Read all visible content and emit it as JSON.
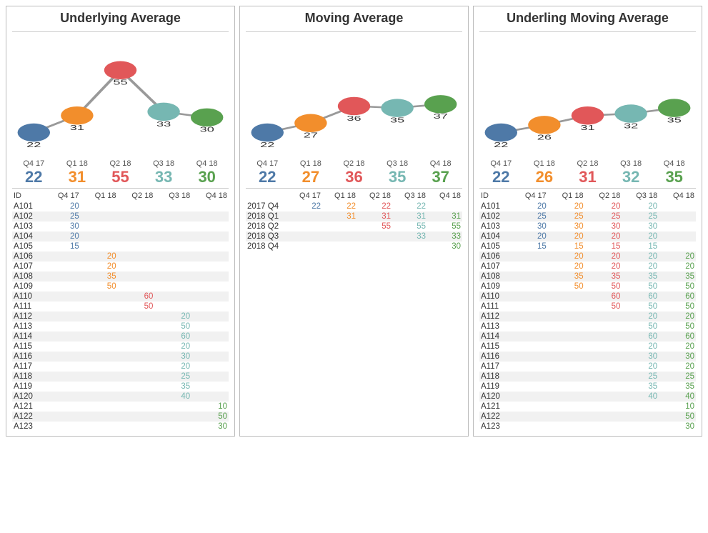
{
  "colors": [
    "#4e79a7",
    "#f28e2c",
    "#e15759",
    "#76b7b2",
    "#59a14f"
  ],
  "quarters": [
    "Q4 17",
    "Q1 18",
    "Q2 18",
    "Q3 18",
    "Q4 18"
  ],
  "panels": [
    {
      "title": "Underlying Average",
      "summary": [
        22,
        31,
        55,
        33,
        30
      ],
      "id_label": "ID",
      "rows": [
        {
          "id": "A101",
          "cells": [
            20,
            null,
            null,
            null,
            null
          ]
        },
        {
          "id": "A102",
          "cells": [
            25,
            null,
            null,
            null,
            null
          ]
        },
        {
          "id": "A103",
          "cells": [
            30,
            null,
            null,
            null,
            null
          ]
        },
        {
          "id": "A104",
          "cells": [
            20,
            null,
            null,
            null,
            null
          ]
        },
        {
          "id": "A105",
          "cells": [
            15,
            null,
            null,
            null,
            null
          ]
        },
        {
          "id": "A106",
          "cells": [
            null,
            20,
            null,
            null,
            null
          ]
        },
        {
          "id": "A107",
          "cells": [
            null,
            20,
            null,
            null,
            null
          ]
        },
        {
          "id": "A108",
          "cells": [
            null,
            35,
            null,
            null,
            null
          ]
        },
        {
          "id": "A109",
          "cells": [
            null,
            50,
            null,
            null,
            null
          ]
        },
        {
          "id": "A110",
          "cells": [
            null,
            null,
            60,
            null,
            null
          ]
        },
        {
          "id": "A111",
          "cells": [
            null,
            null,
            50,
            null,
            null
          ]
        },
        {
          "id": "A112",
          "cells": [
            null,
            null,
            null,
            20,
            null
          ]
        },
        {
          "id": "A113",
          "cells": [
            null,
            null,
            null,
            50,
            null
          ]
        },
        {
          "id": "A114",
          "cells": [
            null,
            null,
            null,
            60,
            null
          ]
        },
        {
          "id": "A115",
          "cells": [
            null,
            null,
            null,
            20,
            null
          ]
        },
        {
          "id": "A116",
          "cells": [
            null,
            null,
            null,
            30,
            null
          ]
        },
        {
          "id": "A117",
          "cells": [
            null,
            null,
            null,
            20,
            null
          ]
        },
        {
          "id": "A118",
          "cells": [
            null,
            null,
            null,
            25,
            null
          ]
        },
        {
          "id": "A119",
          "cells": [
            null,
            null,
            null,
            35,
            null
          ]
        },
        {
          "id": "A120",
          "cells": [
            null,
            null,
            null,
            40,
            null
          ]
        },
        {
          "id": "A121",
          "cells": [
            null,
            null,
            null,
            null,
            10
          ]
        },
        {
          "id": "A122",
          "cells": [
            null,
            null,
            null,
            null,
            50
          ]
        },
        {
          "id": "A123",
          "cells": [
            null,
            null,
            null,
            null,
            30
          ]
        }
      ]
    },
    {
      "title": "Moving Average",
      "summary": [
        22,
        27,
        36,
        35,
        37
      ],
      "id_label": "",
      "row_label_style": "period",
      "rows": [
        {
          "id": "2017 Q4",
          "cells": [
            22,
            22,
            22,
            22,
            null
          ]
        },
        {
          "id": "2018 Q1",
          "cells": [
            null,
            31,
            31,
            31,
            31
          ]
        },
        {
          "id": "2018 Q2",
          "cells": [
            null,
            null,
            55,
            55,
            55
          ]
        },
        {
          "id": "2018 Q3",
          "cells": [
            null,
            null,
            null,
            33,
            33
          ]
        },
        {
          "id": "2018 Q4",
          "cells": [
            null,
            null,
            null,
            null,
            30
          ]
        }
      ]
    },
    {
      "title": "Underling Moving Average",
      "summary": [
        22,
        26,
        31,
        32,
        35
      ],
      "id_label": "ID",
      "rows": [
        {
          "id": "A101",
          "cells": [
            20,
            20,
            20,
            20,
            null
          ]
        },
        {
          "id": "A102",
          "cells": [
            25,
            25,
            25,
            25,
            null
          ]
        },
        {
          "id": "A103",
          "cells": [
            30,
            30,
            30,
            30,
            null
          ]
        },
        {
          "id": "A104",
          "cells": [
            20,
            20,
            20,
            20,
            null
          ]
        },
        {
          "id": "A105",
          "cells": [
            15,
            15,
            15,
            15,
            null
          ]
        },
        {
          "id": "A106",
          "cells": [
            null,
            20,
            20,
            20,
            20
          ]
        },
        {
          "id": "A107",
          "cells": [
            null,
            20,
            20,
            20,
            20
          ]
        },
        {
          "id": "A108",
          "cells": [
            null,
            35,
            35,
            35,
            35
          ]
        },
        {
          "id": "A109",
          "cells": [
            null,
            50,
            50,
            50,
            50
          ]
        },
        {
          "id": "A110",
          "cells": [
            null,
            null,
            60,
            60,
            60
          ]
        },
        {
          "id": "A111",
          "cells": [
            null,
            null,
            50,
            50,
            50
          ]
        },
        {
          "id": "A112",
          "cells": [
            null,
            null,
            null,
            20,
            20
          ]
        },
        {
          "id": "A113",
          "cells": [
            null,
            null,
            null,
            50,
            50
          ]
        },
        {
          "id": "A114",
          "cells": [
            null,
            null,
            null,
            60,
            60
          ]
        },
        {
          "id": "A115",
          "cells": [
            null,
            null,
            null,
            20,
            20
          ]
        },
        {
          "id": "A116",
          "cells": [
            null,
            null,
            null,
            30,
            30
          ]
        },
        {
          "id": "A117",
          "cells": [
            null,
            null,
            null,
            20,
            20
          ]
        },
        {
          "id": "A118",
          "cells": [
            null,
            null,
            null,
            25,
            25
          ]
        },
        {
          "id": "A119",
          "cells": [
            null,
            null,
            null,
            35,
            35
          ]
        },
        {
          "id": "A120",
          "cells": [
            null,
            null,
            null,
            40,
            40
          ]
        },
        {
          "id": "A121",
          "cells": [
            null,
            null,
            null,
            null,
            10
          ]
        },
        {
          "id": "A122",
          "cells": [
            null,
            null,
            null,
            null,
            50
          ]
        },
        {
          "id": "A123",
          "cells": [
            null,
            null,
            null,
            null,
            30
          ]
        }
      ]
    }
  ],
  "chart_data": [
    {
      "type": "line",
      "title": "Underlying Average",
      "categories": [
        "Q4 17",
        "Q1 18",
        "Q2 18",
        "Q3 18",
        "Q4 18"
      ],
      "values": [
        22,
        31,
        55,
        33,
        30
      ],
      "ylim": [
        15,
        60
      ],
      "data_labels": true
    },
    {
      "type": "line",
      "title": "Moving Average",
      "categories": [
        "Q4 17",
        "Q1 18",
        "Q2 18",
        "Q3 18",
        "Q4 18"
      ],
      "values": [
        22,
        27,
        36,
        35,
        37
      ],
      "ylim": [
        15,
        60
      ],
      "data_labels": true
    },
    {
      "type": "line",
      "title": "Underling Moving Average",
      "categories": [
        "Q4 17",
        "Q1 18",
        "Q2 18",
        "Q3 18",
        "Q4 18"
      ],
      "values": [
        22,
        26,
        31,
        32,
        35
      ],
      "ylim": [
        15,
        60
      ],
      "data_labels": true
    }
  ]
}
